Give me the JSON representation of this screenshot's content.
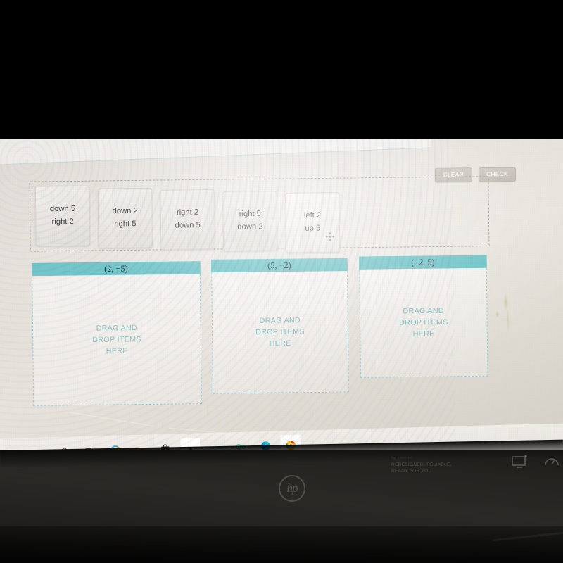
{
  "app": {
    "type": "drag-and-drop-math-activity"
  },
  "toolbar": {
    "clear_label": "CLEAR",
    "check_label": "CHECK"
  },
  "tile_bank": {
    "tiles": [
      {
        "line1": "down 5",
        "line2": "right 2"
      },
      {
        "line1": "down 2",
        "line2": "right 5"
      },
      {
        "line1": "right 2",
        "line2": "down 5"
      },
      {
        "line1": "right 5",
        "line2": "down 2"
      },
      {
        "line1": "left 2",
        "line2": "up 5",
        "handle": "move-icon"
      }
    ]
  },
  "dropzones": [
    {
      "header": "(2, −5)",
      "placeholder": "DRAG AND\nDROP ITEMS\nHERE"
    },
    {
      "header": "(5, −2)",
      "placeholder": "DRAG AND\nDROP ITEMS\nHERE"
    },
    {
      "header": "(−2, 5)",
      "placeholder": "DRAG AND\nDROP ITEMS\nHERE"
    }
  ],
  "taskbar": {
    "icons": [
      {
        "name": "search-icon",
        "glyph": "○"
      },
      {
        "name": "task-view-icon",
        "glyph": "⌸"
      },
      {
        "name": "internet-explorer-icon",
        "glyph": "e"
      },
      {
        "name": "file-explorer-icon",
        "glyph": "▰"
      },
      {
        "name": "microsoft-store-icon",
        "glyph": "■"
      },
      {
        "name": "app-icon",
        "glyph": "a"
      },
      {
        "name": "dropbox-icon",
        "glyph": "✦"
      },
      {
        "name": "loop-icon",
        "glyph": "∞"
      },
      {
        "name": "microsoft-edge-icon",
        "glyph": "●"
      },
      {
        "name": "google-chrome-icon",
        "glyph": "●",
        "active": true
      }
    ]
  },
  "monitor": {
    "brand": "hp",
    "sticker_brand": "hp monitor",
    "sticker_line1": "REDESIGNED. RELIABLE.",
    "sticker_line2": "READY FOR YOU",
    "controls": [
      {
        "name": "display-menu-icon"
      },
      {
        "name": "power-gauge-icon"
      }
    ]
  },
  "colors": {
    "header_teal": "#73c7ca",
    "placeholder_teal": "#8fc3c3",
    "dashed_border": "#a9a49c",
    "tile_face": "#eceae4"
  }
}
